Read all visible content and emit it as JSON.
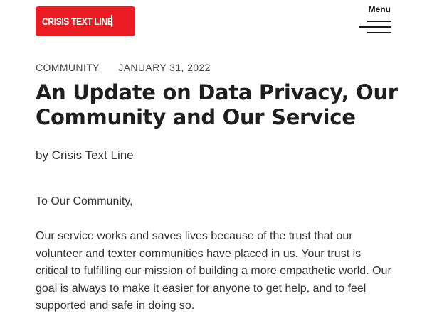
{
  "header": {
    "logo_text": "CRISIS TEXT LINE",
    "menu_label": "Menu",
    "brand_color": "#ec1c24"
  },
  "post": {
    "category": "COMMUNITY",
    "date": "JANUARY 31, 2022",
    "title": "An Update on Data Privacy, Our Community and Our Service",
    "byline": "by Crisis Text Line",
    "salutation": "To Our Community,",
    "paragraph": "Our service works and saves lives because of the trust that our volunteer and texter communities have placed in us. Your trust is critical to fulfilling our mission of building a more empathetic world. Our goal is always to make it easier for anyone to get help, and to feel supported and safe in doing so."
  },
  "icons": {
    "menu": "hamburger-menu-icon"
  }
}
